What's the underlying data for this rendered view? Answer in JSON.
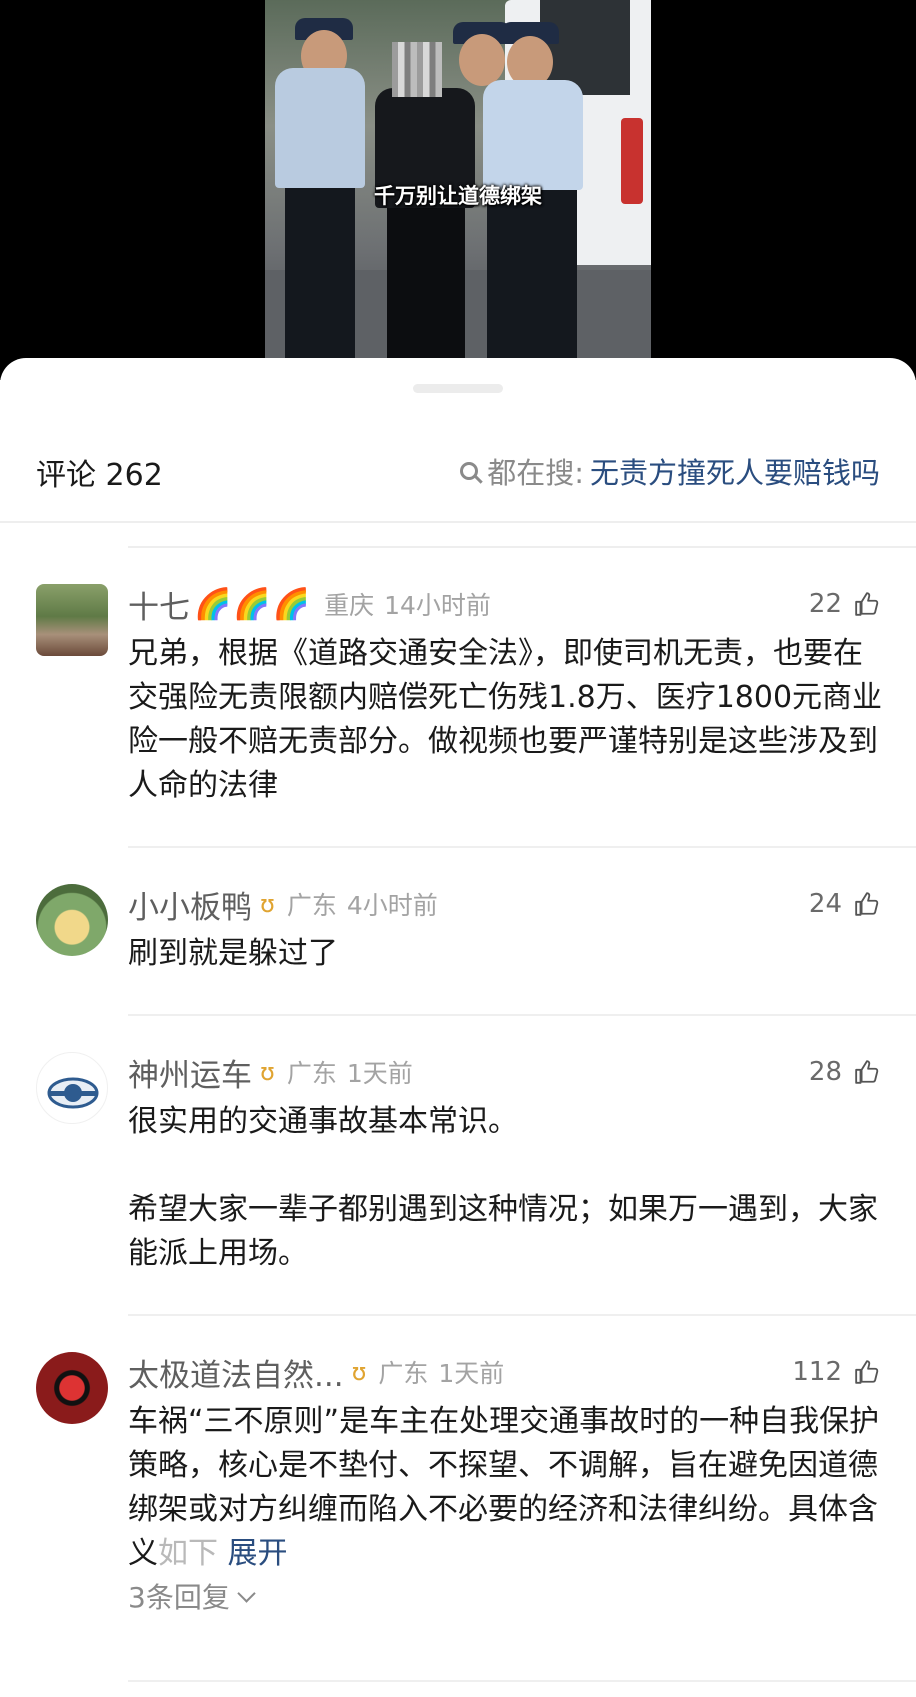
{
  "video": {
    "subtitle": "千万别让道德绑架"
  },
  "header": {
    "comments_label": "评论 262",
    "search_label": "都在搜:",
    "search_keyword": "无责方撞死人要赔钱吗"
  },
  "comments": [
    {
      "name": "十七",
      "badge": "🌈🌈🌈",
      "location": "重庆",
      "time": "14小时前",
      "likes": "22",
      "text": "兄弟，根据《道路交通安全法》，即使司机无责，也要在交强险无责限额内赔偿死亡伤残1.8万、医疗1800元商业险一般不赔无责部分。做视频也要严谨特别是这些涉及到人命的法律"
    },
    {
      "name": "小小板鸭",
      "badge": "ʊ",
      "location": "广东",
      "time": "4小时前",
      "likes": "24",
      "text": "刷到就是躲过了"
    },
    {
      "name": "神州运车",
      "badge": "ʊ",
      "location": "广东",
      "time": "1天前",
      "likes": "28",
      "text": "很实用的交通事故基本常识。\n\n希望大家一辈子都别遇到这种情况；如果万一遇到，大家能派上用场。"
    },
    {
      "name": "太极道法自然...",
      "badge": "ʊ",
      "location": "广东",
      "time": "1天前",
      "likes": "112",
      "text": "车祸“三不原则”是车主在处理交通事故时的一种自我保护策略，核心是不垫付、不探望、不调解，旨在避免因道德绑架或对方纠缠而陷入不必要的经济和法律纠纷。具体含义",
      "text_fade": "如下",
      "expand_label": "展开",
      "replies_label": "3条回复"
    }
  ]
}
